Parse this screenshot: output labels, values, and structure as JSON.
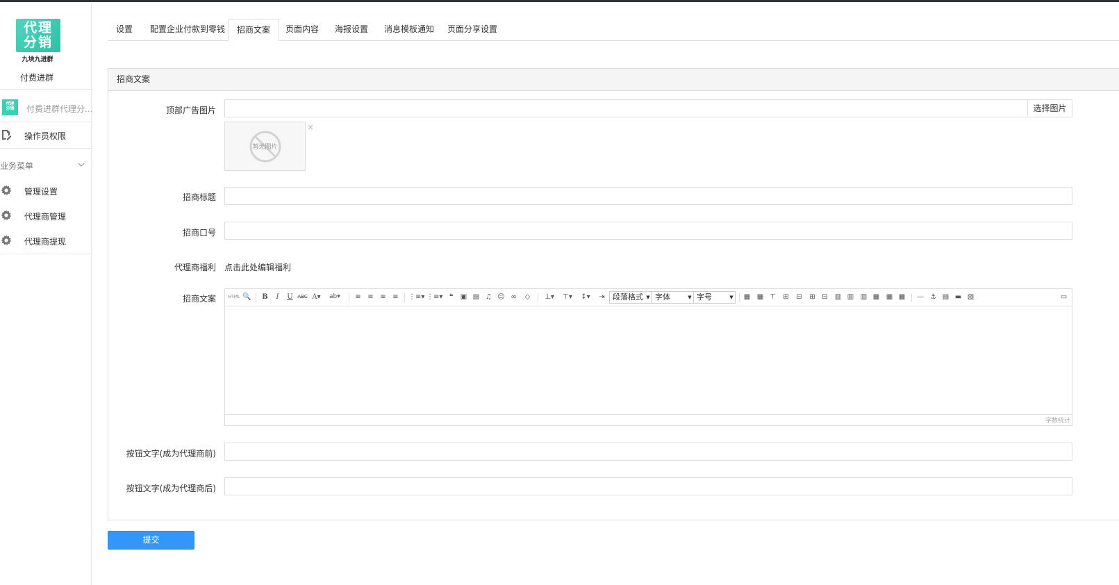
{
  "sidebar": {
    "logo_line1": "代理",
    "logo_line2": "分销",
    "logo_sub": "九块九进群",
    "app_name": "付费进群",
    "plugin_name": "付费进群代理分...",
    "operator_label": "操作员权限",
    "group_label": "业务菜单",
    "menu": [
      {
        "label": "管理设置"
      },
      {
        "label": "代理商管理"
      },
      {
        "label": "代理商提现"
      }
    ]
  },
  "tabs": [
    {
      "label": "设置"
    },
    {
      "label": "配置企业付款到零钱"
    },
    {
      "label": "招商文案",
      "active": true
    },
    {
      "label": "页面内容"
    },
    {
      "label": "海报设置"
    },
    {
      "label": "消息模板通知"
    },
    {
      "label": "页面分享设置"
    }
  ],
  "panel": {
    "title": "招商文案",
    "fields": {
      "top_image_label": "顶部广告图片",
      "top_image_value": "",
      "select_image_button": "选择图片",
      "no_image_text": "暂无图片",
      "remove_icon": "×",
      "title_label": "招商标题",
      "title_value": "",
      "slogan_label": "招商口号",
      "slogan_value": "",
      "welfare_label": "代理商福利",
      "welfare_link": "点击此处编辑福利",
      "copy_label": "招商文案",
      "btn_before_label": "按钮文字(成为代理商前)",
      "btn_before_value": "",
      "btn_after_label": "按钮文字(成为代理商后)",
      "btn_after_value": ""
    },
    "editor": {
      "html_label": "HTML",
      "combo_paragraph": "段落格式",
      "combo_font": "字体",
      "combo_size": "字号",
      "word_count": "字数统计"
    }
  },
  "submit_label": "提交",
  "colors": {
    "accent": "#3296fa",
    "logo": "#3ccdb2",
    "border": "#dddddd"
  }
}
